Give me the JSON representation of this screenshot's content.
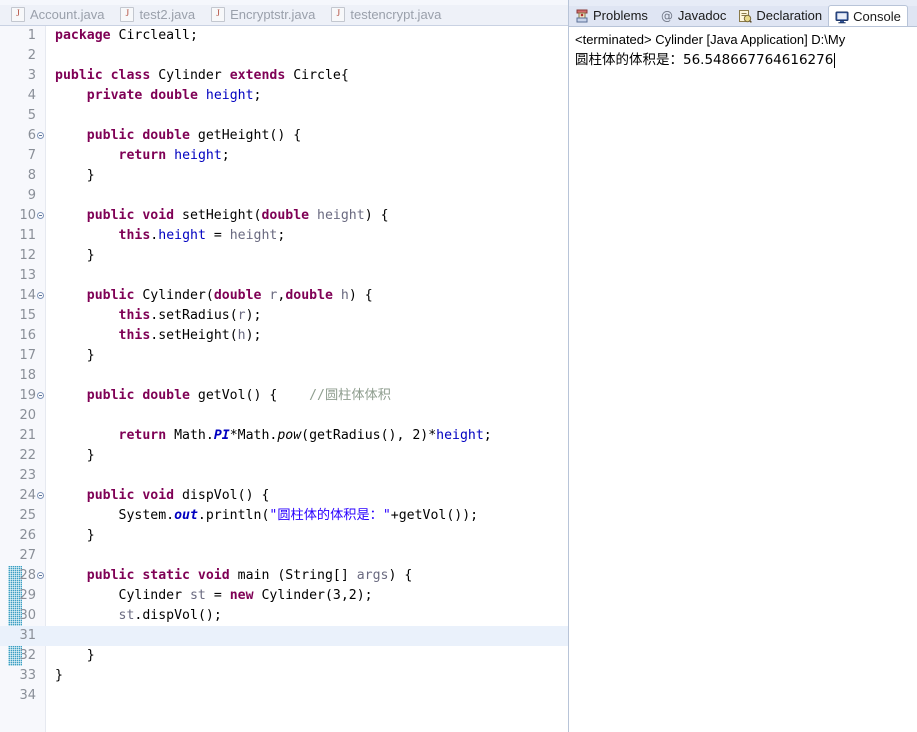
{
  "editor": {
    "tabs": [
      {
        "label": "Account.java",
        "icon": "java-file-icon",
        "active": false
      },
      {
        "label": "test2.java",
        "icon": "java-file-icon",
        "active": false
      },
      {
        "label": "Encryptstr.java",
        "icon": "java-file-icon",
        "active": false
      },
      {
        "label": "testencrypt.java",
        "icon": "java-file-icon",
        "active": false
      }
    ],
    "current_line": 31,
    "change_bar_lines": [
      28,
      29,
      30,
      31,
      32
    ],
    "lines": [
      {
        "n": "1",
        "fold": false,
        "html": "<span class='kw'>package</span> Circleall;"
      },
      {
        "n": "2",
        "fold": false,
        "html": ""
      },
      {
        "n": "3",
        "fold": false,
        "html": "<span class='kw'>public class</span> Cylinder <span class='kw'>extends</span> Circle{"
      },
      {
        "n": "4",
        "fold": false,
        "html": "    <span class='kw'>private double</span> <span class='fld'>height</span>;"
      },
      {
        "n": "5",
        "fold": false,
        "html": ""
      },
      {
        "n": "6",
        "fold": true,
        "html": "    <span class='kw'>public double</span> getHeight() {"
      },
      {
        "n": "7",
        "fold": false,
        "html": "        <span class='kw'>return</span> <span class='fld'>height</span>;"
      },
      {
        "n": "8",
        "fold": false,
        "html": "    }"
      },
      {
        "n": "9",
        "fold": false,
        "html": ""
      },
      {
        "n": "10",
        "fold": true,
        "html": "    <span class='kw'>public void</span> setHeight(<span class='kw'>double</span> <span class='prm'>height</span>) {"
      },
      {
        "n": "11",
        "fold": false,
        "html": "        <span class='kw'>this</span>.<span class='fld'>height</span> = <span class='prm'>height</span>;"
      },
      {
        "n": "12",
        "fold": false,
        "html": "    }"
      },
      {
        "n": "13",
        "fold": false,
        "html": ""
      },
      {
        "n": "14",
        "fold": true,
        "html": "    <span class='kw'>public</span> Cylinder(<span class='kw'>double</span> <span class='prm'>r</span>,<span class='kw'>double</span> <span class='prm'>h</span>) {"
      },
      {
        "n": "15",
        "fold": false,
        "html": "        <span class='kw'>this</span>.setRadius(<span class='prm'>r</span>);"
      },
      {
        "n": "16",
        "fold": false,
        "html": "        <span class='kw'>this</span>.setHeight(<span class='prm'>h</span>);"
      },
      {
        "n": "17",
        "fold": false,
        "html": "    }"
      },
      {
        "n": "18",
        "fold": false,
        "html": ""
      },
      {
        "n": "19",
        "fold": true,
        "html": "    <span class='kw'>public double</span> getVol() {    <span class='cmt'>//圆柱体体积</span>"
      },
      {
        "n": "20",
        "fold": false,
        "html": ""
      },
      {
        "n": "21",
        "fold": false,
        "html": "        <span class='kw'>return</span> Math.<span class='sfld'>PI</span>*Math.<span class='smth'>pow</span>(getRadius(), 2)*<span class='fld'>height</span>;"
      },
      {
        "n": "22",
        "fold": false,
        "html": "    }"
      },
      {
        "n": "23",
        "fold": false,
        "html": ""
      },
      {
        "n": "24",
        "fold": true,
        "html": "    <span class='kw'>public void</span> dispVol() {"
      },
      {
        "n": "25",
        "fold": false,
        "html": "        System.<span class='sfld'>out</span>.println(<span class='str'>\"圆柱体的体积是：\"</span>+getVol());"
      },
      {
        "n": "26",
        "fold": false,
        "html": "    }"
      },
      {
        "n": "27",
        "fold": false,
        "html": ""
      },
      {
        "n": "28",
        "fold": true,
        "html": "    <span class='kw'>public static void</span> main (String[] <span class='prm'>args</span>) {"
      },
      {
        "n": "29",
        "fold": false,
        "html": "        Cylinder <span class='prm'>st</span> = <span class='kw'>new</span> Cylinder(3,2);"
      },
      {
        "n": "30",
        "fold": false,
        "html": "        <span class='prm'>st</span>.dispVol();"
      },
      {
        "n": "31",
        "fold": false,
        "html": ""
      },
      {
        "n": "32",
        "fold": false,
        "html": "    }"
      },
      {
        "n": "33",
        "fold": false,
        "html": "}"
      },
      {
        "n": "34",
        "fold": false,
        "html": ""
      }
    ]
  },
  "views": {
    "tabs": [
      {
        "label": "Problems",
        "icon": "problems-icon",
        "active": false
      },
      {
        "label": "Javadoc",
        "icon": "javadoc-icon",
        "active": false
      },
      {
        "label": "Declaration",
        "icon": "declaration-icon",
        "active": false
      },
      {
        "label": "Console",
        "icon": "console-icon",
        "active": true
      }
    ]
  },
  "console": {
    "header": "<terminated> Cylinder [Java Application] D:\\My",
    "output": "圆柱体的体积是：56.548667764616276"
  },
  "colors": {
    "keyword": "#7f0055",
    "field": "#0000c0",
    "string": "#2a00ff",
    "comment": "#8f9e8f",
    "change_bar": "#3c9fc4",
    "current_line": "#eaf1fb",
    "tabbar_bg": "#eef1f8",
    "viewtab_bg": "#dfe5f3"
  }
}
